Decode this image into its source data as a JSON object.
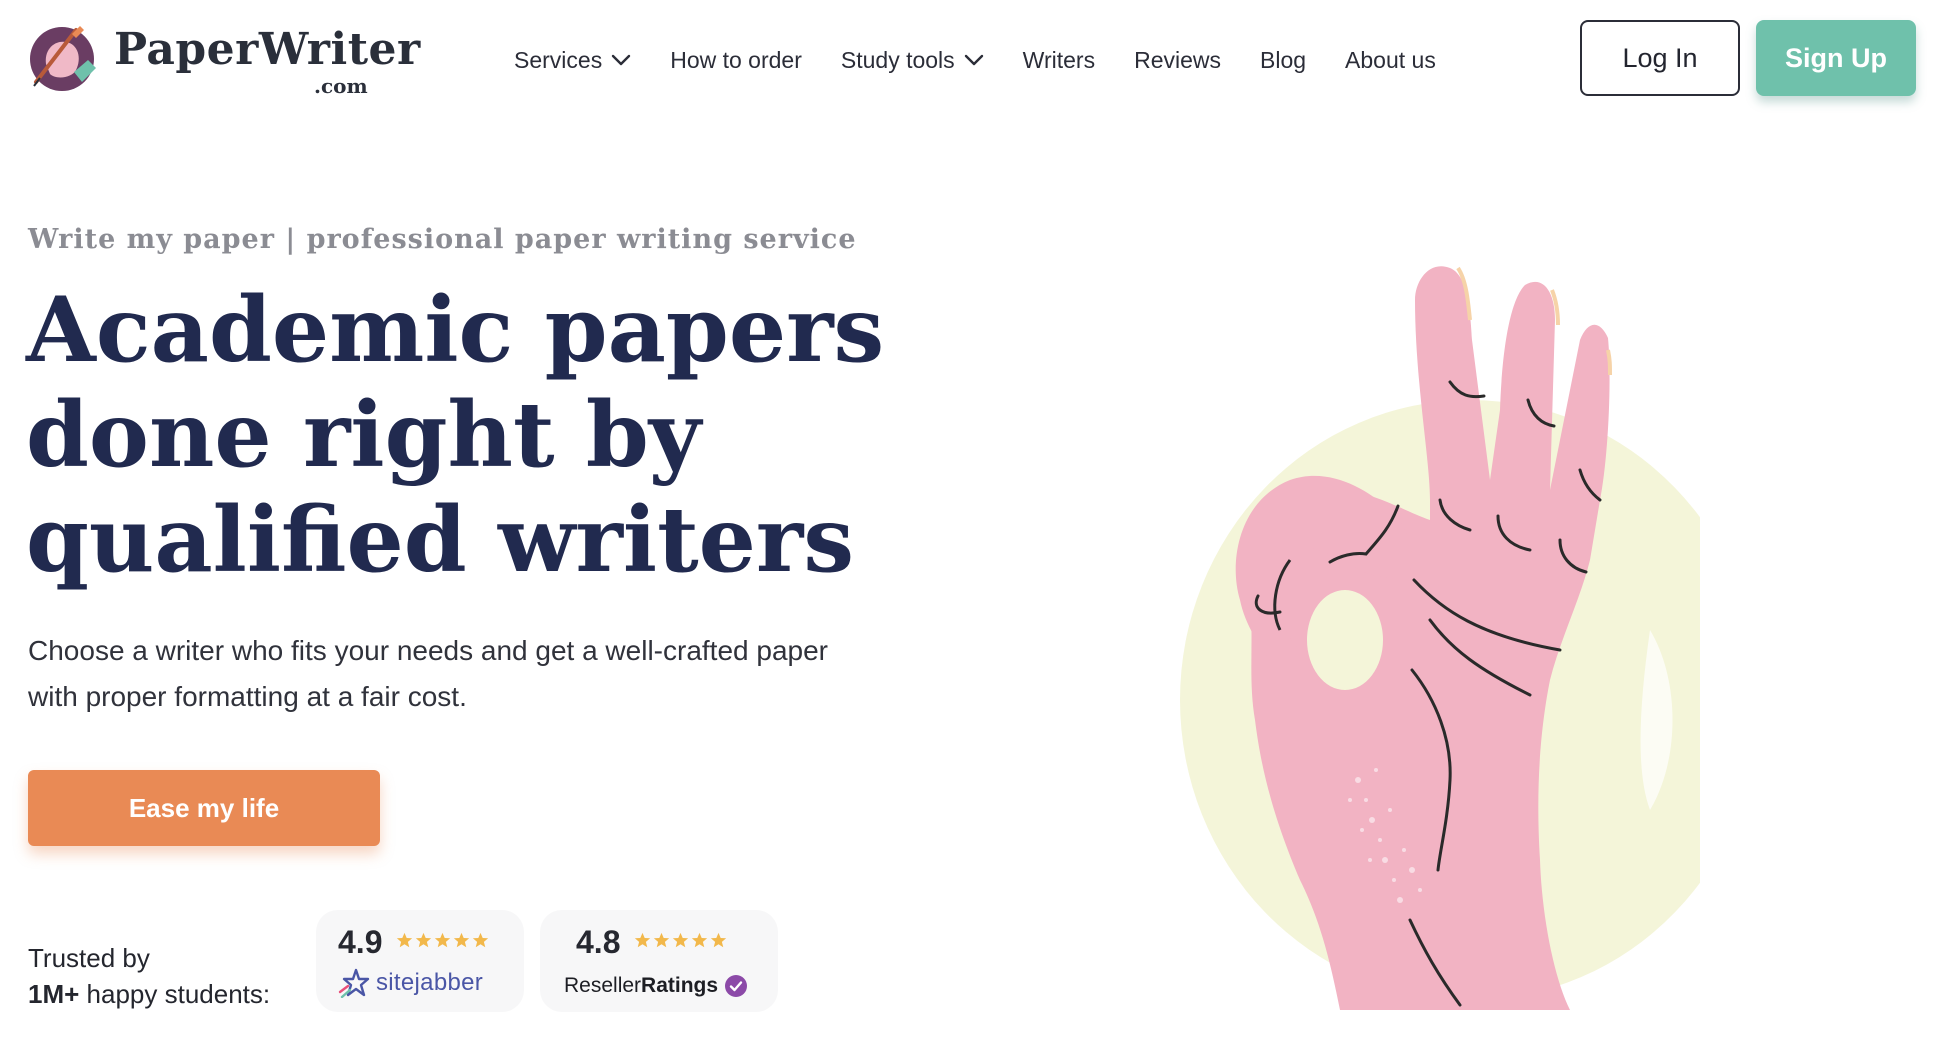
{
  "header": {
    "logo": {
      "brand": "PaperWriter",
      "tld": ".com",
      "icon": "pen-portrait-logo-icon"
    },
    "nav": [
      {
        "label": "Services",
        "has_dropdown": true
      },
      {
        "label": "How to order",
        "has_dropdown": false
      },
      {
        "label": "Study tools",
        "has_dropdown": true
      },
      {
        "label": "Writers",
        "has_dropdown": false
      },
      {
        "label": "Reviews",
        "has_dropdown": false
      },
      {
        "label": "Blog",
        "has_dropdown": false
      },
      {
        "label": "About us",
        "has_dropdown": false
      }
    ],
    "login_label": "Log In",
    "signup_label": "Sign Up"
  },
  "hero": {
    "eyebrow": "Write my paper | professional paper writing service",
    "headline_lines": [
      "Academic papers",
      "done right by",
      "qualified writers"
    ],
    "subtext_lines": [
      "Choose a writer who fits your needs and get a well-crafted paper",
      "with proper formatting at a fair cost."
    ],
    "cta_label": "Ease my life",
    "illustration_icon": "ok-hand-gesture-icon"
  },
  "trust": {
    "line1": "Trusted by",
    "line2_bold": "1M+",
    "line2_rest": " happy students:",
    "badges": [
      {
        "score": "4.9",
        "stars": 5,
        "brand": "sitejabber",
        "icon": "sitejabber-star-icon"
      },
      {
        "score": "4.8",
        "stars": 5,
        "brand_regular": "Reseller",
        "brand_bold": "Ratings",
        "icon": "verified-check-icon"
      }
    ]
  },
  "colors": {
    "primary_text": "#212a4f",
    "signup_bg": "#6fc1ab",
    "cta_bg": "#e98a55",
    "star": "#f2b84b",
    "hand": "#f2b3c3",
    "circle": "#f4f5d9",
    "reseller_check": "#8c4aa8",
    "sitejabber_blue": "#4a56a6"
  }
}
